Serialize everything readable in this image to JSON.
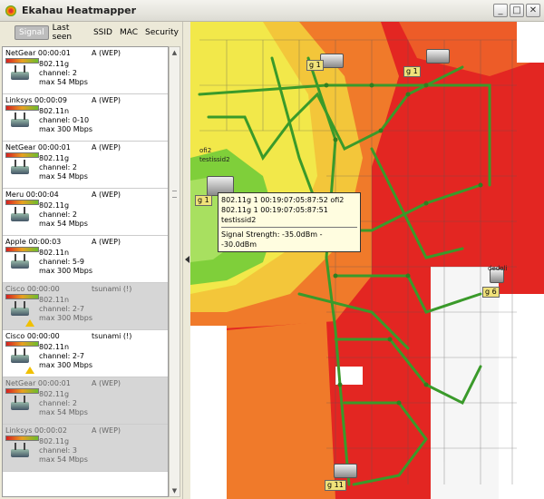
{
  "window": {
    "title": "Ekahau Heatmapper",
    "min": "_",
    "max": "□",
    "close": "✕"
  },
  "tabs": [
    "Signal",
    "Last seen",
    "SSID",
    "MAC",
    "Security"
  ],
  "access_points": [
    {
      "name": "NetGear 00:00:01",
      "security": "A (WEP)",
      "line1": "802.11g",
      "line2": "channel: 2",
      "line3": "max 54 Mbps",
      "dim": false,
      "warn": false
    },
    {
      "name": "Linksys 00:00:09",
      "security": "A (WEP)",
      "line1": "802.11n",
      "line2": "channel: 0-10",
      "line3": "max 300 Mbps",
      "dim": false,
      "warn": false
    },
    {
      "name": "NetGear 00:00:01",
      "security": "A (WEP)",
      "line1": "802.11g",
      "line2": "channel: 2",
      "line3": "max 54 Mbps",
      "dim": false,
      "warn": false
    },
    {
      "name": "Meru 00:00:04",
      "security": "A (WEP)",
      "line1": "802.11g",
      "line2": "channel: 2",
      "line3": "max 54 Mbps",
      "dim": false,
      "warn": false
    },
    {
      "name": "Apple 00:00:03",
      "security": "A (WEP)",
      "line1": "802.11n",
      "line2": "channel: 5-9",
      "line3": "max 300 Mbps",
      "dim": false,
      "warn": false
    },
    {
      "name": "Cisco 00:00:00",
      "security": "tsunami (!)",
      "line1": "802.11n",
      "line2": "channel: 2-7",
      "line3": "max 300 Mbps",
      "dim": true,
      "warn": true
    },
    {
      "name": "Cisco 00:00:00",
      "security": "tsunami (!)",
      "line1": "802.11n",
      "line2": "channel: 2-7",
      "line3": "max 300 Mbps",
      "dim": false,
      "warn": true
    },
    {
      "name": "NetGear 00:00:01",
      "security": "A (WEP)",
      "line1": "802.11g",
      "line2": "channel: 2",
      "line3": "max 54 Mbps",
      "dim": true,
      "warn": false
    },
    {
      "name": "Linksys 00:00:02",
      "security": "A (WEP)",
      "line1": "802.11g",
      "line2": "channel: 3",
      "line3": "max 54 Mbps",
      "dim": true,
      "warn": false
    }
  ],
  "map": {
    "ap_labels": [
      {
        "text": "g 1"
      },
      {
        "text": "g 1"
      },
      {
        "text": "g 1"
      },
      {
        "text": "g 6"
      },
      {
        "text": "g 11"
      }
    ],
    "ap_names": [
      "testissid2",
      "ofi2",
      "dedoli"
    ],
    "tooltip": {
      "line1": "802.11g 1 00:19:07:05:87:52 ofi2",
      "line2": "802.11g 1 00:19:07:05:87:51 testissid2",
      "signal": "Signal Strength: -35.0dBm - -30.0dBm"
    },
    "colors": {
      "red": "#e32622",
      "orange": "#f07a2a",
      "yellow": "#f2e84a",
      "green": "#7fcf3a",
      "path": "#3a9a2a"
    }
  }
}
